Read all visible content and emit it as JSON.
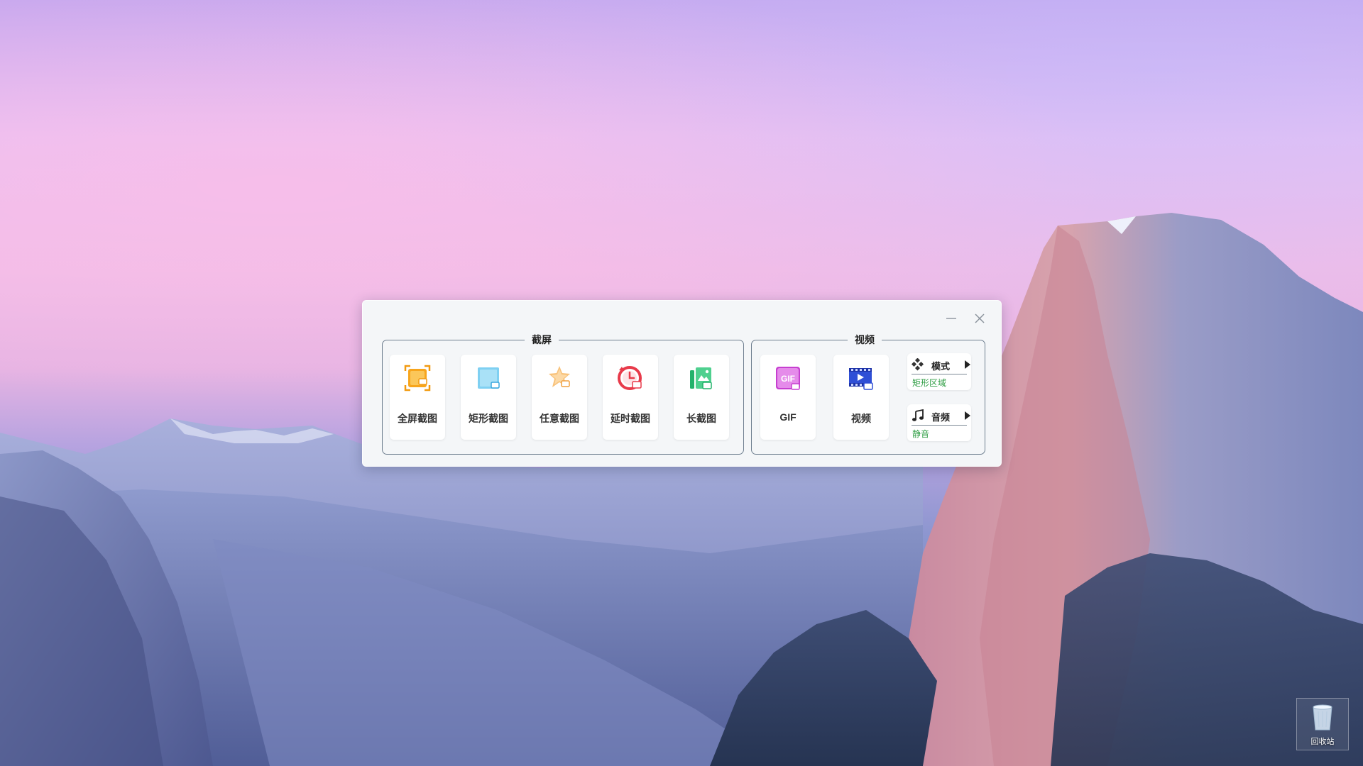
{
  "desktop": {
    "recycle_bin_label": "回收站"
  },
  "toolbar": {
    "capture_group": {
      "title": "截屏",
      "tiles": [
        {
          "label": "全屏截图",
          "icon": "fullscreen-capture-icon"
        },
        {
          "label": "矩形截图",
          "icon": "rectangle-capture-icon"
        },
        {
          "label": "任意截图",
          "icon": "freeform-capture-icon"
        },
        {
          "label": "延时截图",
          "icon": "delayed-capture-icon"
        },
        {
          "label": "长截图",
          "icon": "scrolling-capture-icon"
        }
      ]
    },
    "video_group": {
      "title": "视频",
      "tiles": [
        {
          "label": "GIF",
          "icon": "gif-icon"
        },
        {
          "label": "视频",
          "icon": "video-icon"
        }
      ],
      "mode": {
        "label": "模式",
        "value": "矩形区域",
        "icon": "mode-diamond-icon"
      },
      "audio": {
        "label": "音频",
        "value": "静音",
        "icon": "music-note-icon"
      }
    },
    "gif_badge": "GIF"
  },
  "colors": {
    "option_value": "#2f9e44",
    "group_border": "#6f7f90"
  }
}
